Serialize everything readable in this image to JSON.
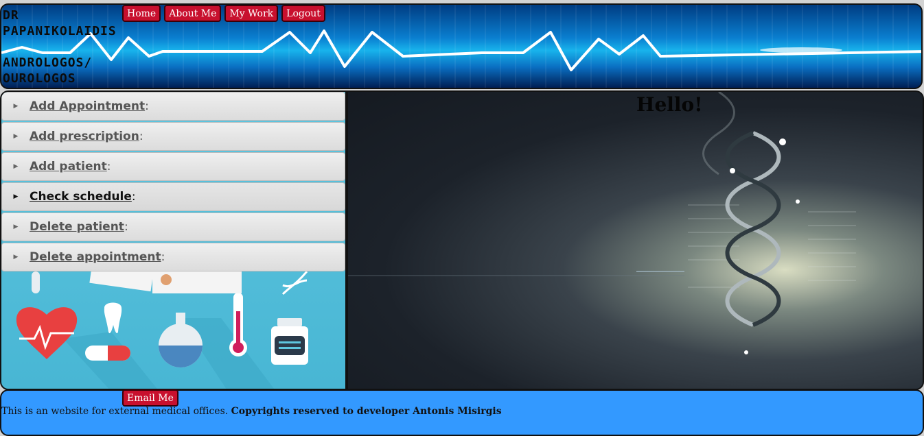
{
  "header": {
    "title": "DR\nPAPANIKOLAIDIS\n\nANDROLOGOS/\nOUROLOGOS",
    "nav": [
      "Home",
      "About Me",
      "My Work",
      "Logout"
    ]
  },
  "menu": {
    "items": [
      {
        "label": "Add Appointment",
        "suffix": ":"
      },
      {
        "label": "Add prescription",
        "suffix": ":"
      },
      {
        "label": "Add patient",
        "suffix": ":"
      },
      {
        "label": "Check schedule",
        "suffix": ":"
      },
      {
        "label": "Delete patient",
        "suffix": ":"
      },
      {
        "label": "Delete appointment",
        "suffix": ":"
      }
    ],
    "active_index": 3
  },
  "content": {
    "greeting": "Hello!"
  },
  "footer": {
    "email_button": "Email Me",
    "text": "This is an website for external medical offices.",
    "copyright": "Copyrights reserved to developer Antonis Misirgis"
  },
  "icons": {
    "left_panel": [
      "heart-icon",
      "tooth-icon",
      "pill-icon",
      "flask-icon",
      "thermometer-icon",
      "medicine-bottle-icon",
      "dna-icon",
      "test-tube-icon"
    ],
    "right_panel": "dna-helix-image"
  },
  "colors": {
    "nav_button": "#c8102e",
    "footer_bg": "#3399ff",
    "header_blue": "#0a7fd0"
  }
}
